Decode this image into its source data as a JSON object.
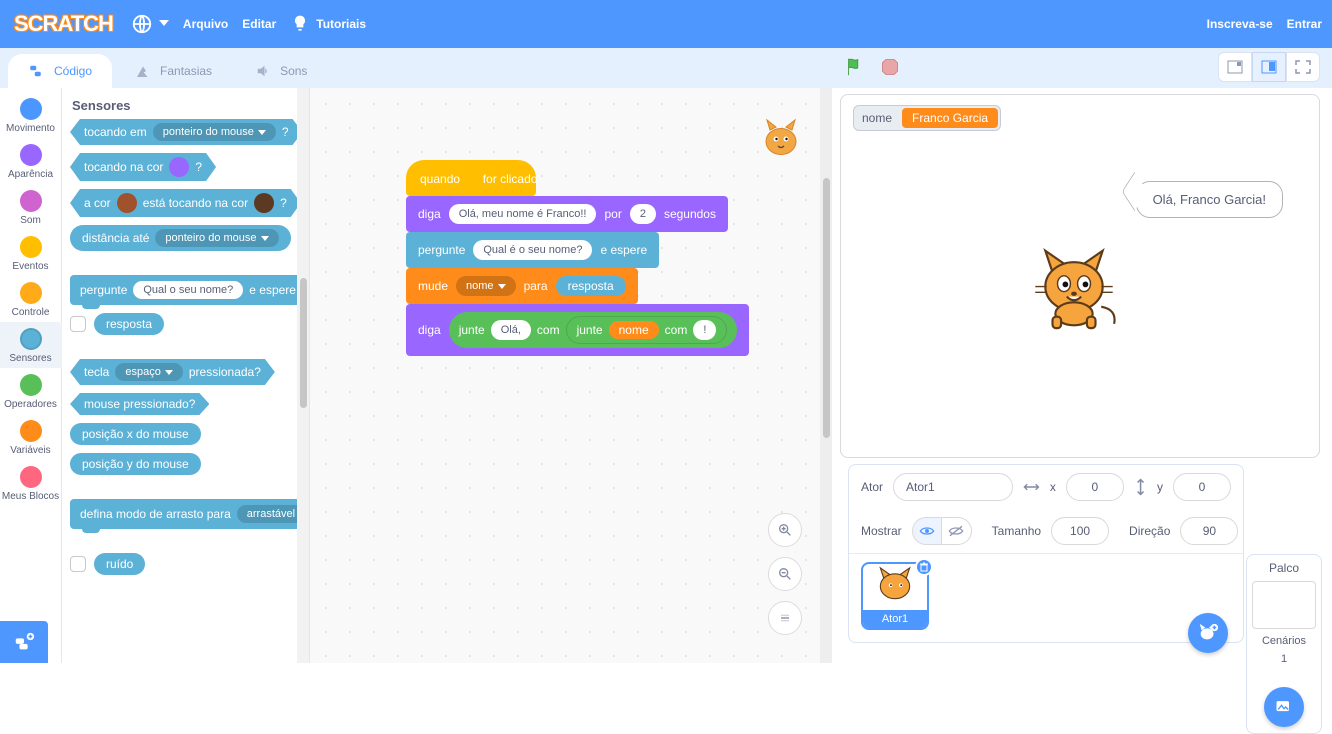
{
  "menu": {
    "file": "Arquivo",
    "edit": "Editar",
    "tutorials": "Tutoriais",
    "join": "Inscreva-se",
    "signin": "Entrar"
  },
  "tabs": {
    "code": "Código",
    "costumes": "Fantasias",
    "sounds": "Sons"
  },
  "categories": {
    "motion": {
      "label": "Movimento",
      "color": "#4c97ff"
    },
    "looks": {
      "label": "Aparência",
      "color": "#9966ff"
    },
    "sound": {
      "label": "Som",
      "color": "#cf63cf"
    },
    "events": {
      "label": "Eventos",
      "color": "#ffbf00"
    },
    "control": {
      "label": "Controle",
      "color": "#ffab19"
    },
    "sensing": {
      "label": "Sensores",
      "color": "#5cb1d6"
    },
    "operators": {
      "label": "Operadores",
      "color": "#59c059"
    },
    "variables": {
      "label": "Variáveis",
      "color": "#ff8c1a"
    },
    "myblocks": {
      "label": "Meus Blocos",
      "color": "#ff6680"
    }
  },
  "palette": {
    "heading": "Sensores",
    "touching_label": "tocando em",
    "touching_opt": "ponteiro do mouse",
    "touching_color_label": "tocando na cor",
    "touching_color_q": "?",
    "touching_color_swatch": "#9966ff",
    "color_touching_a": "a cor",
    "color_touching_b": "está tocando na cor",
    "color_touching_c1": "#a0522d",
    "color_touching_c2": "#5c3a21",
    "distance_label": "distância até",
    "distance_opt": "ponteiro do mouse",
    "ask_label": "pergunte",
    "ask_default": "Qual o seu nome?",
    "ask_wait": "e espere",
    "answer_reporter": "resposta",
    "key_label": "tecla",
    "key_opt": "espaço",
    "key_pressed": "pressionada?",
    "mouse_down": "mouse pressionado?",
    "mouse_x": "posição x do mouse",
    "mouse_y": "posição y do mouse",
    "dragmode_a": "defina modo de arrasto para",
    "dragmode_opt": "arrastável",
    "loudness": "ruído"
  },
  "script": {
    "hat": "quando        for clicado",
    "say1_a": "diga",
    "say1_msg": "Olá, meu nome é Franco!!",
    "say1_b": "por",
    "say1_secs": "2",
    "say1_c": "segundos",
    "ask_a": "pergunte",
    "ask_msg": "Qual é o seu nome?",
    "ask_b": "e espere",
    "setvar_a": "mude",
    "setvar_var": "nome",
    "setvar_b": "para",
    "setvar_val": "resposta",
    "say2_a": "diga",
    "join1": "junte",
    "join1_a": "Olá,",
    "join1_b": "com",
    "join2": "junte",
    "join2_a": "nome",
    "join2_b": "com",
    "join2_c": "!"
  },
  "stage": {
    "var_label": "nome",
    "var_value": "Franco Garcia",
    "bubble": "Olá, Franco Garcia!"
  },
  "sprite": {
    "label_sprite": "Ator",
    "name": "Ator1",
    "x_label": "x",
    "x": "0",
    "y_label": "y",
    "y": "0",
    "show_label": "Mostrar",
    "size_label": "Tamanho",
    "size": "100",
    "dir_label": "Direção",
    "dir": "90"
  },
  "stage_panel": {
    "title": "Palco",
    "scenes": "Cenários",
    "count": "1"
  }
}
